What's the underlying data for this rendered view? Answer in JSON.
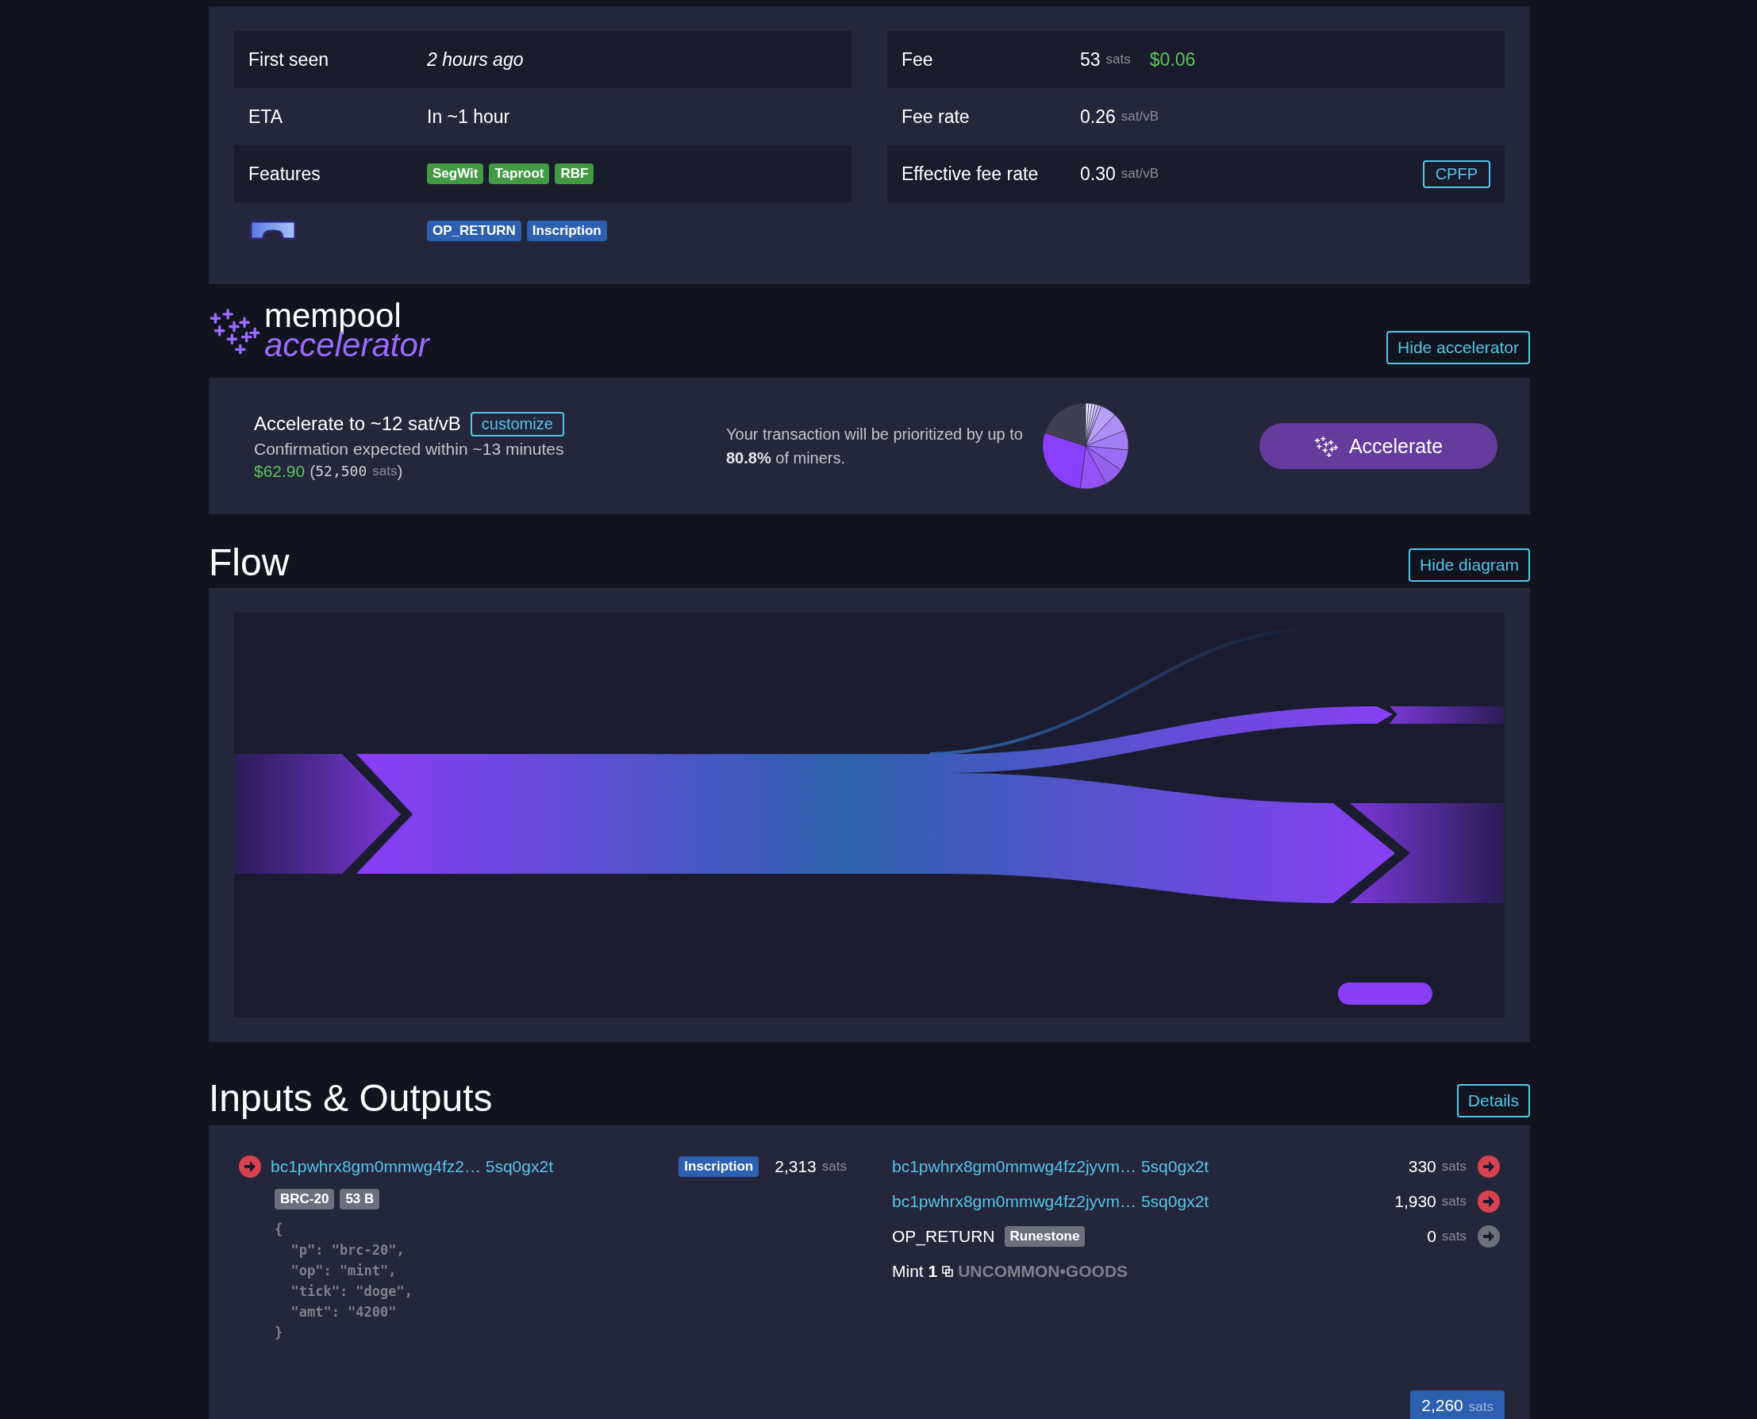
{
  "details": {
    "left": [
      {
        "kind": "text",
        "label": "First seen",
        "value": "2 hours ago",
        "italic": true
      },
      {
        "kind": "text",
        "label": "ETA",
        "value": "In ~1 hour",
        "italic": false
      },
      {
        "kind": "tags",
        "label": "Features",
        "tags": [
          {
            "text": "SegWit",
            "color": "#429b43"
          },
          {
            "text": "Taproot",
            "color": "#429b43"
          },
          {
            "text": "RBF",
            "color": "#429b43"
          }
        ]
      },
      {
        "kind": "icon_tags",
        "tags": [
          {
            "text": "OP_RETURN",
            "color": "#2d60b0"
          },
          {
            "text": "Inscription",
            "color": "#2d60b0"
          }
        ]
      }
    ],
    "right": [
      {
        "kind": "fee",
        "label": "Fee",
        "value": "53",
        "unit": "sats",
        "fiat": "$0.06"
      },
      {
        "kind": "rate",
        "label": "Fee rate",
        "value": "0.26",
        "unit": "sat/vB"
      },
      {
        "kind": "rate",
        "label": "Effective fee rate",
        "value": "0.30",
        "unit": "sat/vB",
        "action": "CPFP"
      }
    ]
  },
  "accelerator": {
    "logo_top": "mempool",
    "logo_bottom": "accelerator",
    "hide_button": "Hide accelerator",
    "target": "Accelerate to ~12 sat/vB",
    "customize": "customize",
    "eta": "Confirmation expected within ~13 minutes",
    "cost_fiat": "$62.90",
    "paren_open": "(",
    "cost_sats": "52,500",
    "cost_unit": "sats",
    "paren_close": ")",
    "note": "Your transaction will be prioritized by up to **80.8%** of miners.",
    "button": "Accelerate"
  },
  "flow": {
    "title": "Flow",
    "hide_button": "Hide diagram"
  },
  "io": {
    "title": "Inputs & Outputs",
    "details_button": "Details",
    "inputs": [
      {
        "address": "bc1pwhrx8gm0mmwg4fz2… 5sq0gx2t",
        "tag": "Inscription",
        "value": "2,313",
        "unit": "sats",
        "spent": true,
        "content_tags": [
          "BRC-20",
          "53 B"
        ],
        "content": "{\n  \"p\": \"brc-20\",\n  \"op\": \"mint\",\n  \"tick\": \"doge\",\n  \"amt\": \"4200\"\n}"
      }
    ],
    "outputs": [
      {
        "kind": "address",
        "address": "bc1pwhrx8gm0mmwg4fz2jyvm… 5sq0gx2t",
        "value": "330",
        "unit": "sats",
        "spent": true
      },
      {
        "kind": "address",
        "address": "bc1pwhrx8gm0mmwg4fz2jyvm… 5sq0gx2t",
        "value": "1,930",
        "unit": "sats",
        "spent": true
      },
      {
        "kind": "op_return",
        "label": "OP_RETURN",
        "tag": "Runestone",
        "value": "0",
        "unit": "sats",
        "spent": false,
        "mint": "Mint **1**",
        "rune": "UNCOMMON•GOODS"
      }
    ],
    "total": {
      "value": "2,260",
      "unit": "sats"
    }
  }
}
